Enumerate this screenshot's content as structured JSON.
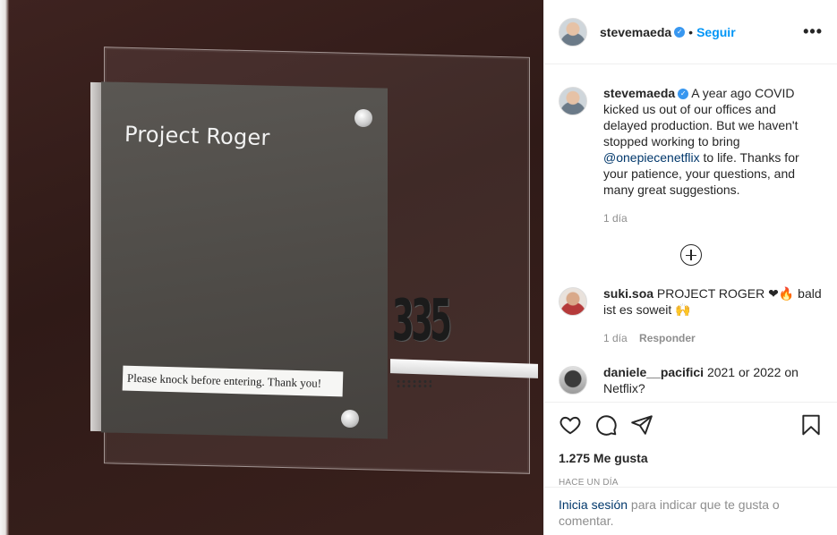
{
  "colors": {
    "accent": "#0095f6",
    "verified": "#3897f0",
    "photo_bg": "#3a211d"
  },
  "photo": {
    "plaque_title": "Project Roger",
    "notice": "Please knock before entering. Thank you!",
    "room_number": "335"
  },
  "header": {
    "username": "stevemaeda",
    "separator": "•",
    "follow_label": "Seguir",
    "more_icon": "more-horizontal-icon"
  },
  "caption": {
    "username": "stevemaeda",
    "text_before": "A year ago COVID kicked us out of our offices and delayed production. But we haven't stopped working to bring ",
    "mention": "@onepiecenetflix",
    "text_after": " to life. Thanks for your patience, your questions, and many great suggestions.",
    "age": "1 día"
  },
  "comments": [
    {
      "username": "suki.soa",
      "text": "PROJECT ROGER ❤🔥 bald ist es soweit 🙌",
      "age": "1 día",
      "reply_label": "Responder"
    },
    {
      "username": "daniele__pacifici",
      "text": "2021 or 2022 on Netflix?"
    }
  ],
  "actions": {
    "icons": [
      "heart-icon",
      "comment-icon",
      "share-icon",
      "bookmark-icon"
    ],
    "likes": "1.275 Me gusta",
    "timestamp": "HACE UN DÍA"
  },
  "login_prompt": {
    "link": "Inicia sesión",
    "text": " para indicar que te gusta o comentar."
  }
}
